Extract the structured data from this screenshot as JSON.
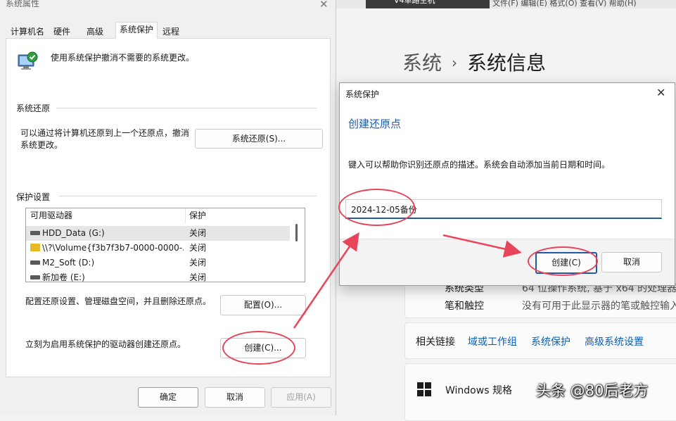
{
  "background_settings": {
    "active_tab": "V4单路主机",
    "menu_text": "文件(F)   编辑(E)   格式(O)   查看(V)   帮助(H)",
    "breadcrumb_parent": "系统",
    "breadcrumb_separator": "›",
    "page_title": "系统信息",
    "specs": [
      {
        "label": "系统类型",
        "value": "64 位操作系统, 基于 x64 的处理器"
      },
      {
        "label": "笔和触控",
        "value": "没有可用于此显示器的笔或触控输入"
      }
    ],
    "related_links_label": "相关链接",
    "related_links": [
      "域或工作组",
      "系统保护",
      "高级系统设置"
    ],
    "windows_spec_label": "Windows 规格",
    "watermark": "头条 @80后老方"
  },
  "system_properties": {
    "title": "系统属性",
    "close_glyph": "✕",
    "tabs": [
      "计算机名",
      "硬件",
      "高级",
      "系统保护",
      "远程"
    ],
    "active_tab_index": 3,
    "intro_text": "使用系统保护撤消不需要的系统更改。",
    "restore_group_label": "系统还原",
    "restore_desc": "可以通过将计算机还原到上一个还原点，撤消系统更改。",
    "restore_button": "系统还原(S)...",
    "protection_group_label": "保护设置",
    "table_headers": [
      "可用驱动器",
      "保护"
    ],
    "drives": [
      {
        "icon": "hdd-icon",
        "name": "HDD_Data (G:)",
        "status": "关闭",
        "selected": true
      },
      {
        "icon": "folder-icon",
        "name": "\\\\?\\Volume{f3b7f3b7-0000-0000-...",
        "status": "关闭",
        "selected": false
      },
      {
        "icon": "hdd-icon",
        "name": "M2_Soft (D:)",
        "status": "关闭",
        "selected": false
      },
      {
        "icon": "hdd-icon",
        "name": "新加卷 (E:)",
        "status": "关闭",
        "selected": false
      }
    ],
    "configure_desc": "配置还原设置、管理磁盘空间，并且删除还原点。",
    "configure_button": "配置(O)...",
    "create_desc": "立刻为启用系统保护的驱动器创建还原点。",
    "create_button": "创建(C)...",
    "ok_button": "确定",
    "cancel_button": "取消",
    "apply_button": "应用(A)"
  },
  "create_dialog": {
    "title": "系统保护",
    "close_glyph": "✕",
    "heading": "创建还原点",
    "description": "键入可以帮助你识别还原点的描述。系统会自动添加当前日期和时间。",
    "input_value": "2024-12-05备份",
    "create_button": "创建(C)",
    "cancel_button": "取消"
  },
  "colors": {
    "accent": "#1e5aa8",
    "annotation": "#e8455b",
    "link": "#0a5fb4"
  }
}
